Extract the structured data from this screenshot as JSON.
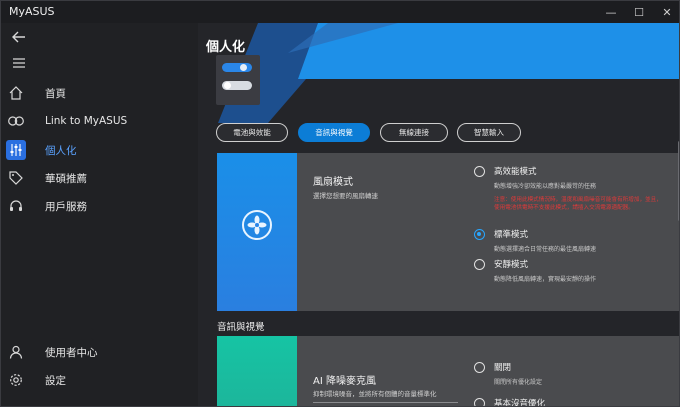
{
  "app": {
    "title": "MyASUS"
  },
  "window_controls": {
    "minimize": "—",
    "maximize": "☐",
    "close": "✕"
  },
  "sidebar": {
    "items": [
      {
        "label": "首頁",
        "icon": "home-icon"
      },
      {
        "label": "Link to MyASUS",
        "icon": "link-icon"
      },
      {
        "label": "個人化",
        "icon": "sliders-icon",
        "active": true
      },
      {
        "label": "華碩推薦",
        "icon": "tag-icon"
      },
      {
        "label": "用戶服務",
        "icon": "headset-icon"
      }
    ],
    "bottom": [
      {
        "label": "使用者中心",
        "icon": "user-icon"
      },
      {
        "label": "設定",
        "icon": "gear-icon"
      }
    ]
  },
  "main": {
    "title": "個人化",
    "tabs": [
      {
        "label": "電池與效能"
      },
      {
        "label": "音訊與視覺",
        "active": true
      },
      {
        "label": "無線連接"
      },
      {
        "label": "智慧輸入"
      }
    ],
    "fan_card": {
      "title": "風扇模式",
      "desc": "選擇您想要的風扇轉速",
      "options": [
        {
          "label": "高效能模式",
          "desc": "動態增強冷卻效能以應對最嚴苛的任務",
          "selected": false
        },
        {
          "label": "標準模式",
          "desc": "動態選擇適合日常任務的最佳風扇轉速",
          "selected": true
        },
        {
          "label": "安靜模式",
          "desc": "動態降低風扇轉速，實現最安靜的操作",
          "selected": false
        }
      ],
      "warning": "注意：使用此模式情況時，溫度和風扇噪音可能會有所增加，並且，使用電池供電時不支援此模式，請插入交流電源適配器。"
    },
    "section_heading": "音訊與視覺",
    "ai_card": {
      "title": "AI 降噪麥克風",
      "desc": "抑制環境噪音，並將所有個體的音量標準化",
      "options": [
        {
          "label": "關閉",
          "desc": "關閉所有優化設定",
          "selected": false
        },
        {
          "label": "基本沒音優化",
          "desc": "",
          "selected": false
        }
      ]
    }
  },
  "colors": {
    "accent": "#0c7dd6",
    "active_nav": "#2a6fe0",
    "fan_stripe": "#1a8fe8",
    "ai_stripe": "#1fbfa0",
    "warning": "#e03a3a"
  }
}
